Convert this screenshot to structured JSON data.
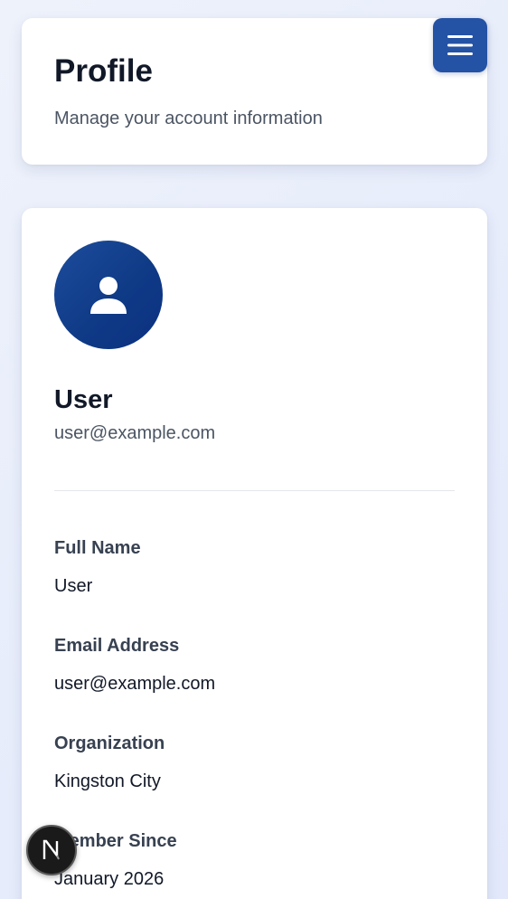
{
  "header": {
    "title": "Profile",
    "subtitle": "Manage your account information"
  },
  "menu_button": {
    "icon": "hamburger-menu-icon"
  },
  "profile": {
    "avatar_icon": "user-icon",
    "name": "User",
    "email": "user@example.com",
    "fields": [
      {
        "label": "Full Name",
        "value": "User"
      },
      {
        "label": "Email Address",
        "value": "user@example.com"
      },
      {
        "label": "Organization",
        "value": "Kingston City"
      },
      {
        "label": "Member Since",
        "value": "January 2026"
      }
    ]
  },
  "dev_badge": {
    "letter": "N",
    "icon": "nextjs-logo-icon"
  },
  "colors": {
    "accent": "#2452a5",
    "avatar": "#0f3a86",
    "background": "#e8edfb"
  }
}
